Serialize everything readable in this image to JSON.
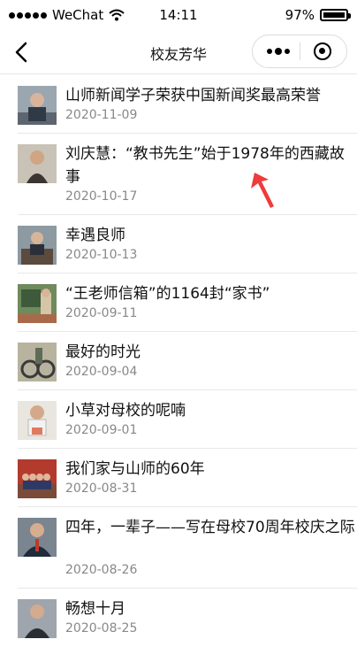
{
  "status_bar": {
    "carrier": "WeChat",
    "time": "14:11",
    "battery": "97%"
  },
  "nav": {
    "title": "校友芳华"
  },
  "articles": [
    {
      "title": "山师新闻学子荣获中国新闻奖最高荣誉",
      "date": "2020-11-09"
    },
    {
      "title": "刘庆慧：“教书先生”始于1978年的西藏故事",
      "date": "2020-10-17"
    },
    {
      "title": "幸遇良师",
      "date": "2020-10-13"
    },
    {
      "title": "“王老师信箱”的1164封“家书”",
      "date": "2020-09-11"
    },
    {
      "title": "最好的时光",
      "date": "2020-09-04"
    },
    {
      "title": "小草对母校的呢喃",
      "date": "2020-09-01"
    },
    {
      "title": "我们家与山师的60年",
      "date": "2020-08-31"
    },
    {
      "title": "四年，一辈子——写在母校70周年校庆之际",
      "date": "2020-08-26"
    },
    {
      "title": "畅想十月",
      "date": "2020-08-25"
    }
  ],
  "colors": {
    "annotation_arrow": "#ee3b3b",
    "date_text": "#888888",
    "divider": "#e8e8e8"
  }
}
